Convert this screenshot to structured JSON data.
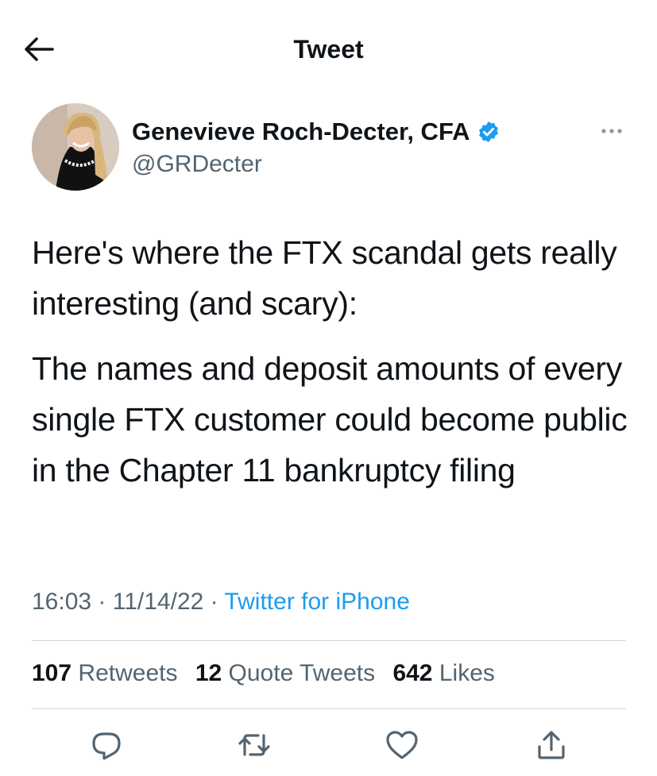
{
  "header": {
    "title": "Tweet",
    "back_icon": "arrow-left-icon"
  },
  "author": {
    "name": "Genevieve Roch-Decter, CFA",
    "handle": "@GRDecter",
    "verified": true,
    "verified_color": "#1d9bf0"
  },
  "tweet": {
    "paragraphs": [
      "Here's where the FTX scandal gets really interesting (and scary):",
      "The names and deposit amounts of every single FTX customer could become public in the Chapter 11 bankruptcy filing"
    ],
    "time": "16:03",
    "date": "11/14/22",
    "separator": "·",
    "source": "Twitter for iPhone"
  },
  "stats": {
    "retweets": {
      "count": "107",
      "label": "Retweets"
    },
    "quotes": {
      "count": "12",
      "label": "Quote Tweets"
    },
    "likes": {
      "count": "642",
      "label": "Likes"
    }
  },
  "actions": [
    "reply-icon",
    "retweet-icon",
    "like-icon",
    "share-icon"
  ],
  "colors": {
    "text": "#0f1419",
    "secondary": "#536471",
    "accent": "#1d9bf0",
    "divider": "#d3d9de"
  }
}
